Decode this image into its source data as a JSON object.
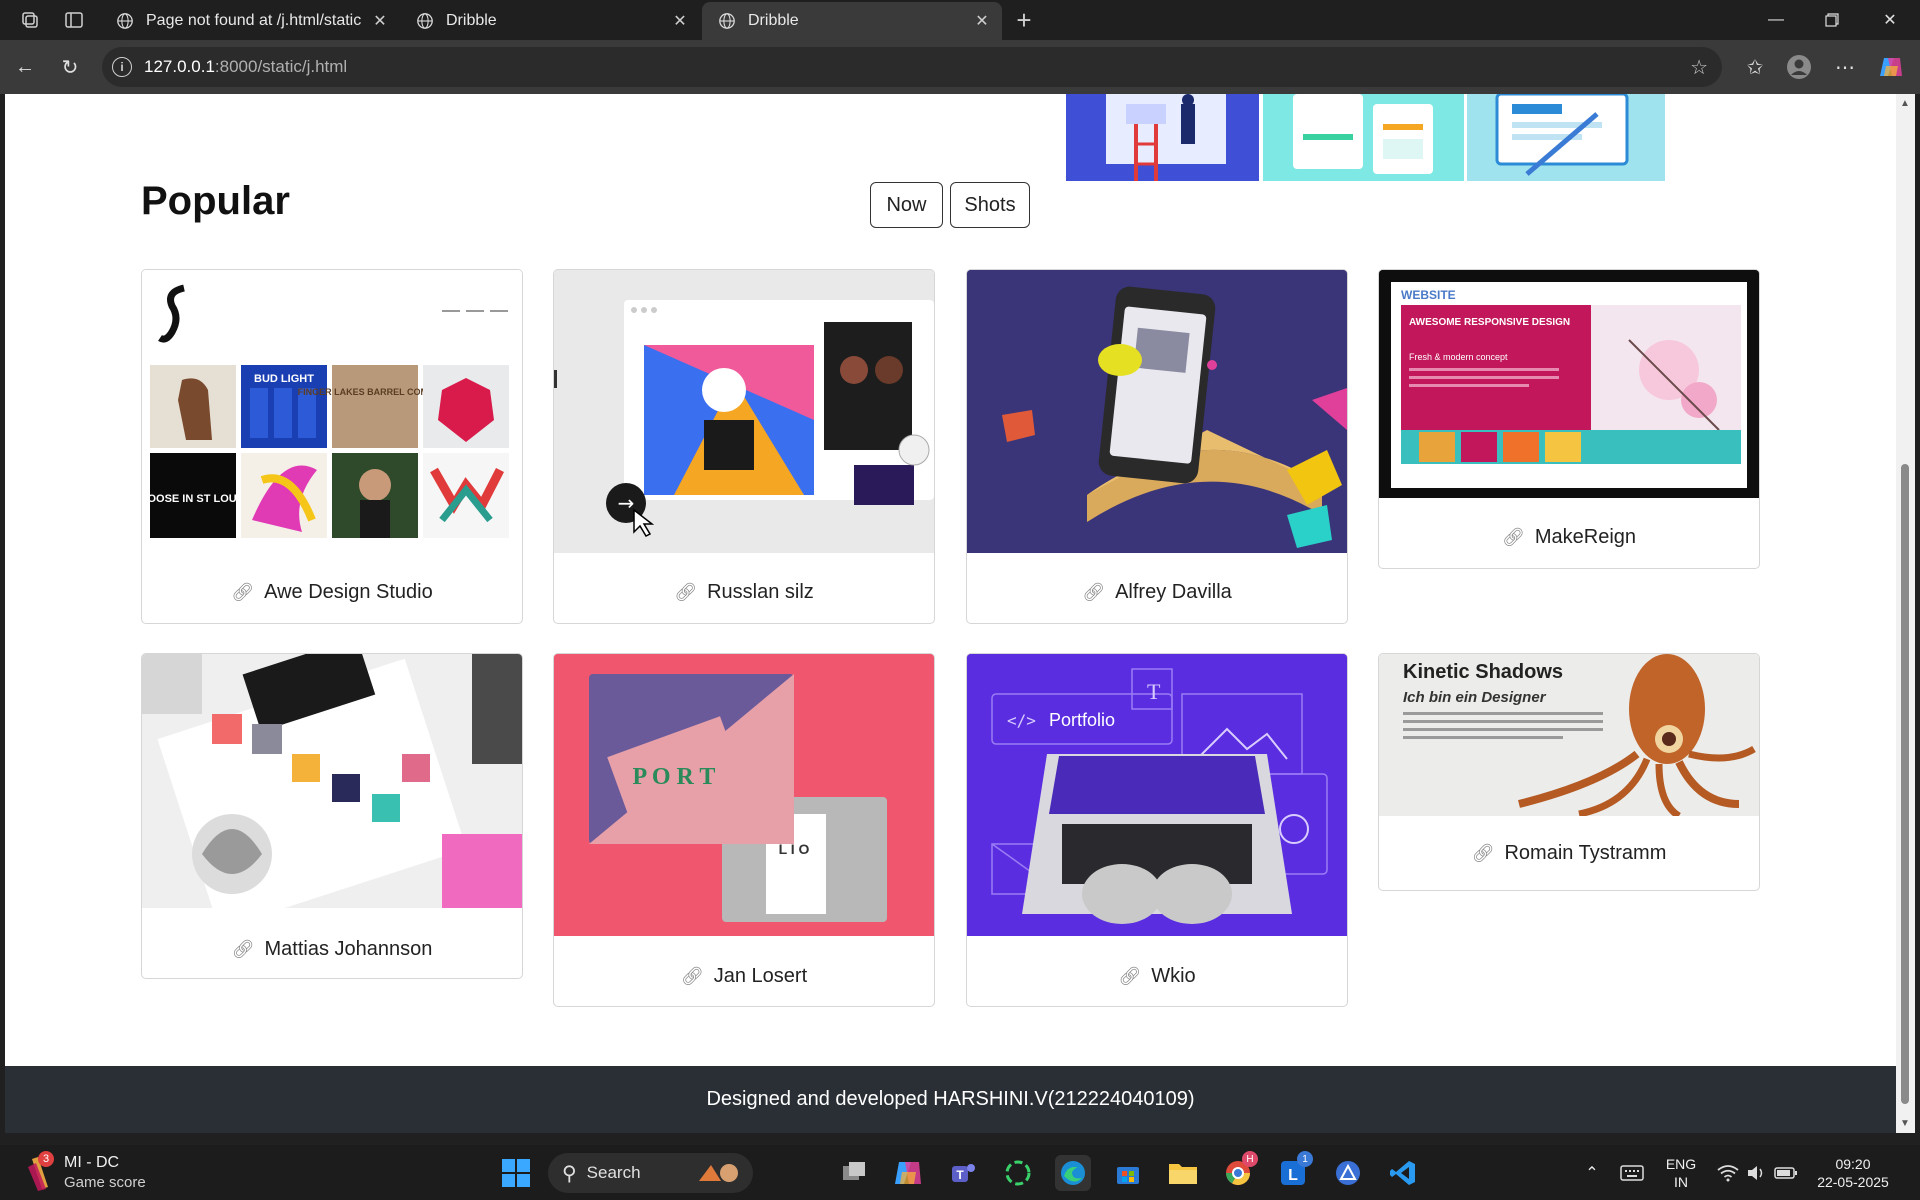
{
  "browser": {
    "tabs": [
      {
        "title": "Page not found at /j.html/static",
        "active": false
      },
      {
        "title": "Dribble",
        "active": false
      },
      {
        "title": "Dribble",
        "active": true
      }
    ],
    "url_host": "127.0.0.1",
    "url_rest": ":8000/static/j.html"
  },
  "page": {
    "section_title": "Popular",
    "filters": [
      "Now",
      "Shots"
    ],
    "cards": [
      {
        "label": "Awe Design Studio"
      },
      {
        "label": "Russlan silz"
      },
      {
        "label": "Alfrey Davilla"
      },
      {
        "label": "MakeReign"
      },
      {
        "label": "Mattias Johannson"
      },
      {
        "label": "Jan Losert"
      },
      {
        "label": "Wkio"
      },
      {
        "label": "Romain Tystramm"
      }
    ],
    "thumb_text": {
      "makereign_site": "WEBSITE",
      "makereign_headline": "AWESOME RESPONSIVE DESIGN",
      "makereign_sub": "Fresh & modern concept",
      "romain_title": "Kinetic Shadows",
      "romain_sub": "Ich bin ein Designer",
      "wkio_portfolio": "Portfolio",
      "awe_goose": "GOOSE IN ST LOUIS",
      "awe_bud": "BUD LIGHT",
      "awe_finger": "FINGER LAKES BARREL COMPANY"
    },
    "footer": "Designed and developed HARSHINI.V(212224040109)"
  },
  "taskbar": {
    "game_title": "MI - DC",
    "game_sub": "Game score",
    "game_badge": "3",
    "search_label": "Search",
    "lang_top": "ENG",
    "lang_bottom": "IN",
    "time": "09:20",
    "date": "22-05-2025",
    "teams_badge": "1",
    "chrome_badge": "H"
  },
  "colors": {
    "footer_bg": "#2a2f35",
    "wkio_bg": "#5b2de0",
    "jan_bg": "#f0566e",
    "makereign_bg": "#c2185b",
    "alfrey_bg": "#3a3478"
  }
}
